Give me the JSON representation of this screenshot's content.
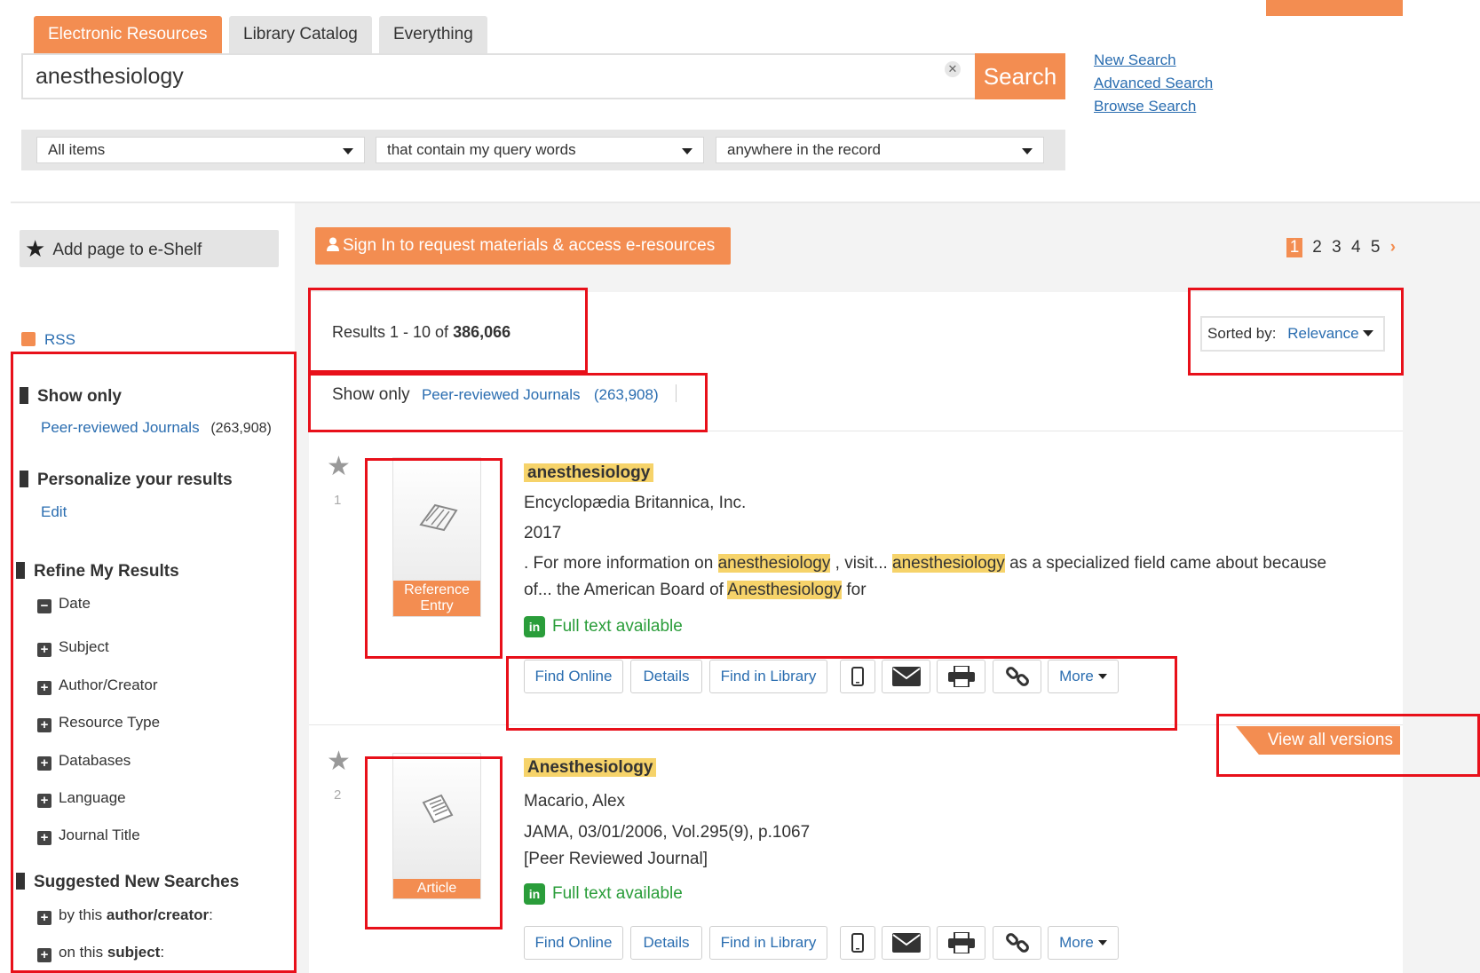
{
  "tabs": [
    {
      "label": "Electronic Resources"
    },
    {
      "label": "Library Catalog"
    },
    {
      "label": "Everything"
    }
  ],
  "search": {
    "query": "anesthesiology",
    "button_label": "Search"
  },
  "side_links": {
    "new_search": "New Search",
    "advanced_search": "Advanced Search",
    "browse_search": "Browse Search"
  },
  "filters": {
    "scope": "All items",
    "match": "that contain my query words",
    "field": "anywhere in the record"
  },
  "eshelf": {
    "label": "Add page to e-Shelf"
  },
  "signin": {
    "label": "Sign In to request materials & access e-resources"
  },
  "pager": {
    "pages": [
      "1",
      "2",
      "3",
      "4",
      "5"
    ]
  },
  "results_summary": {
    "prefix": "Results 1 - 10 of",
    "total": "386,066"
  },
  "sort": {
    "label": "Sorted by:",
    "value": "Relevance"
  },
  "show_only_bar": {
    "label": "Show only",
    "link": "Peer-reviewed Journals",
    "count": "(263,908)"
  },
  "sidebar": {
    "rss": "RSS",
    "show_only": {
      "heading": "Show only",
      "link": "Peer-reviewed Journals",
      "count": "(263,908)"
    },
    "personalize": {
      "heading": "Personalize your results",
      "edit": "Edit"
    },
    "refine": {
      "heading": "Refine My Results",
      "date": "Date",
      "items": [
        "Subject",
        "Author/Creator",
        "Resource Type",
        "Databases",
        "Language",
        "Journal Title"
      ]
    },
    "suggested": {
      "heading": "Suggested New Searches",
      "by_prefix": "by this",
      "by_bold": "author/creator",
      "by_colon": ":",
      "on_prefix": "on this",
      "on_bold": "subject",
      "on_colon": ":"
    }
  },
  "results": [
    {
      "number": "1",
      "type": "Reference Entry",
      "title": "anesthesiology",
      "publisher": "Encyclopædia Britannica, Inc.",
      "year": "2017",
      "snippet": {
        "s1": ". For more information on",
        "h1": "anesthesiology",
        "s2": ", visit...",
        "h2": "anesthesiology",
        "s3": "as a specialized field came about because",
        "s4": "of... the American Board of",
        "h3": "Anesthesiology",
        "s5": "for"
      },
      "fulltext": "Full text available"
    },
    {
      "number": "2",
      "type": "Article",
      "title": "Anesthesiology",
      "author": "Macario, Alex",
      "source": "JAMA, 03/01/2006, Vol.295(9), p.1067",
      "note": "[Peer Reviewed Journal]",
      "fulltext": "Full text available"
    }
  ],
  "actions": {
    "find_online": "Find Online",
    "details": "Details",
    "find_in_library": "Find in Library",
    "more": "More"
  },
  "view_all_versions": "View all versions",
  "colors": {
    "accent": "#f38d51",
    "link": "#2a6db0",
    "highlight": "#f6d36a",
    "fulltext": "#2a9d3a",
    "annotation": "#e8101a"
  }
}
